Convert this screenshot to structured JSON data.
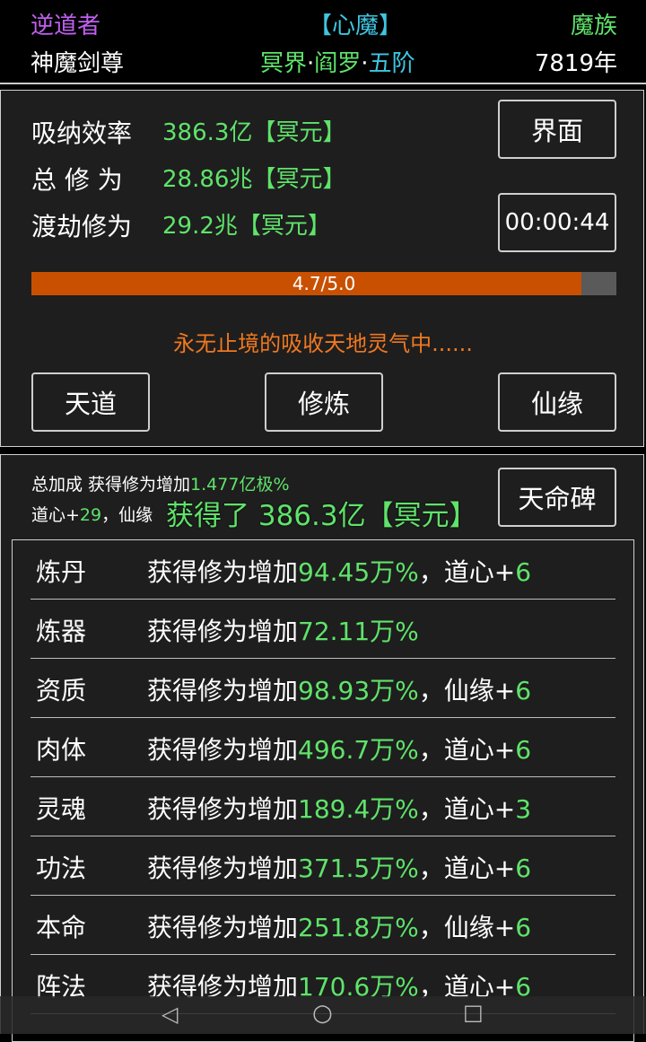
{
  "header": {
    "dao": "逆道者",
    "title": "【心魔】",
    "race": "魔族",
    "name": "神魔剑尊",
    "realm_a": "冥界",
    "realm_b": "阎罗",
    "realm_c": "五阶",
    "years": "7819年"
  },
  "stats": {
    "absorb_label": "吸纳效率",
    "absorb_value": "386.3亿",
    "absorb_unit": "【冥元】",
    "total_label": "总 修 为",
    "total_value": "28.86兆",
    "total_unit": "【冥元】",
    "tribulation_label": "渡劫修为",
    "tribulation_value": "29.2兆",
    "tribulation_unit": "【冥元】",
    "interface_button": "界面",
    "timer": "00:00:44",
    "progress_text": "4.7/5.0",
    "progress_value": 0.94,
    "status_message": "永无止境的吸收天地灵气中......",
    "buttons": [
      "天道",
      "修炼",
      "仙缘"
    ]
  },
  "bonus": {
    "line1_prefix": "总加成 获得修为增加",
    "line1_value": "1.477亿极%",
    "line2_a": "道心+",
    "line2_a_value": "29",
    "line2_b": "，仙缘",
    "gain_message": "获得了 386.3亿【冥元】",
    "stele_button": "天命碑"
  },
  "list": [
    {
      "name": "炼丹",
      "prefix": "获得修为增加",
      "value": "94.45万%",
      "extra_label": "，道心+",
      "extra_value": "6"
    },
    {
      "name": "炼器",
      "prefix": "获得修为增加",
      "value": "72.11万%",
      "extra_label": "",
      "extra_value": ""
    },
    {
      "name": "资质",
      "prefix": "获得修为增加",
      "value": "98.93万%",
      "extra_label": "，仙缘+",
      "extra_value": "6"
    },
    {
      "name": "肉体",
      "prefix": "获得修为增加",
      "value": "496.7万%",
      "extra_label": "，道心+",
      "extra_value": "6"
    },
    {
      "name": "灵魂",
      "prefix": "获得修为增加",
      "value": "189.4万%",
      "extra_label": "，道心+",
      "extra_value": "3"
    },
    {
      "name": "功法",
      "prefix": "获得修为增加",
      "value": "371.5万%",
      "extra_label": "，道心+",
      "extra_value": "6"
    },
    {
      "name": "本命",
      "prefix": "获得修为增加",
      "value": "251.8万%",
      "extra_label": "，仙缘+",
      "extra_value": "6"
    },
    {
      "name": "阵法",
      "prefix": "获得修为增加",
      "value": "170.6万%",
      "extra_label": "，道心+",
      "extra_value": "6"
    }
  ],
  "navbar": {
    "back": "◁",
    "home": "○",
    "recent": "□"
  }
}
